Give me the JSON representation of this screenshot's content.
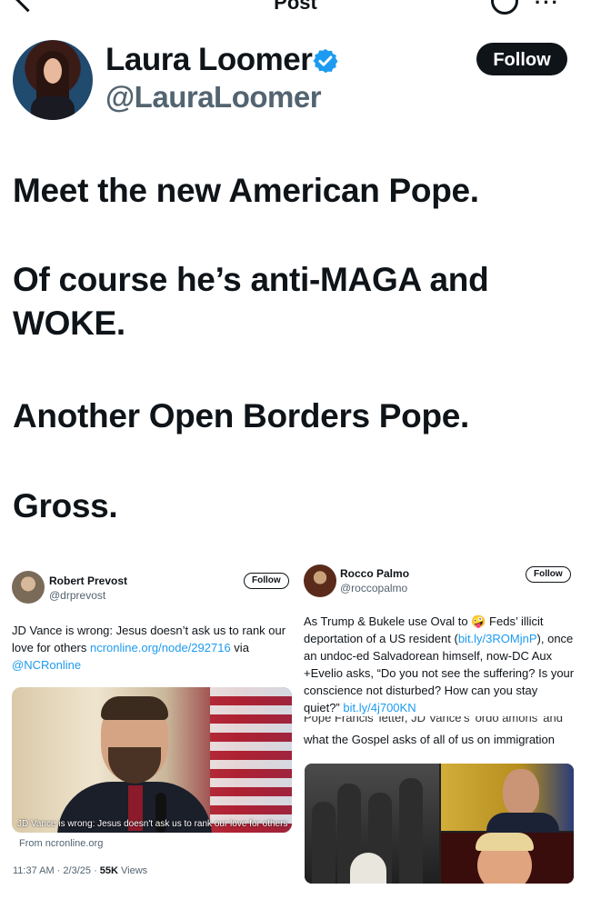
{
  "top_bar": {
    "title": "Post"
  },
  "author": {
    "name": "Laura Loomer",
    "handle": "@LauraLoomer",
    "follow_label": "Follow",
    "verified": true
  },
  "tweet": {
    "paragraphs": [
      "Meet the new American Pope.",
      "Of course he’s anti-MAGA and WOKE.",
      "Another Open Borders Pope.",
      "Gross."
    ]
  },
  "embedded": {
    "left": {
      "name": "Robert Prevost",
      "handle": "@drprevost",
      "follow_label": "Follow",
      "text_start": "JD Vance is wrong: Jesus doesn’t ask us to rank our love for others ",
      "link1": "ncronline.org/node/292716",
      "text_mid": " via ",
      "link2": "@NCRonline",
      "image_caption": "JD Vance is wrong: Jesus doesn't ask us to rank our love for others",
      "from": "From ncronline.org",
      "time": "11:37 AM · 2/3/25 · ",
      "views_count": "55K",
      "views_label": " Views"
    },
    "right": {
      "name": "Rocco Palmo",
      "handle": "@roccopalmo",
      "follow_label": "Follow",
      "text_a": "As Trump & Bukele use Oval to 🤪 Feds’ illicit deportation of a US resident (",
      "link1": "bit.ly/3ROMjnP",
      "text_b": "), once an undoc-ed Salvadorean himself, now-DC Aux +Evelio asks, “Do you not see the suffering? Is your conscience not disturbed? How can you stay quiet?” ",
      "link2": "bit.ly/4j700KN",
      "cut_line": "Pope Francis' letter, JD Vance's 'ordo amoris' and",
      "text_c": "what the Gospel asks of all of us on immigration"
    }
  },
  "icons": {
    "back": "back-arrow-icon",
    "grok": "grok-icon",
    "more": "more-icon",
    "verified": "verified-badge-icon"
  },
  "colors": {
    "text": "#0f1419",
    "secondary": "#536471",
    "link": "#1d9bf0",
    "verified": "#1d9bf0",
    "follow_bg": "#0f1419"
  }
}
